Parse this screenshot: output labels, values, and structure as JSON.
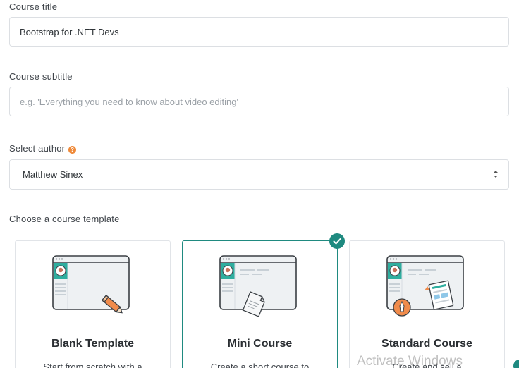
{
  "form": {
    "title_label": "Course title",
    "title_value": "Bootstrap for .NET Devs",
    "subtitle_label": "Course subtitle",
    "subtitle_placeholder": "e.g. 'Everything you need to know about video editing'",
    "author_label": "Select author",
    "author_value": "Matthew Sinex",
    "template_label": "Choose a course template"
  },
  "templates": [
    {
      "title": "Blank Template",
      "desc": "Start from scratch with a",
      "selected": false
    },
    {
      "title": "Mini Course",
      "desc": "Create a short course to",
      "selected": true
    },
    {
      "title": "Standard Course",
      "desc": "Create and sell a",
      "selected": false
    }
  ],
  "watermark": "Activate Windows",
  "colors": {
    "accent": "#1f8a80",
    "help": "#ef8a3a",
    "border": "#dcdfe3"
  }
}
